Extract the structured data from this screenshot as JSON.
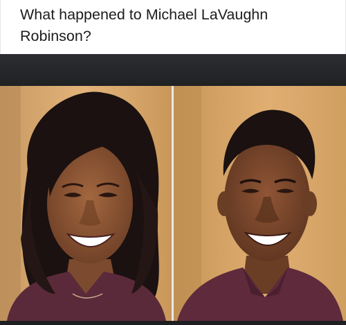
{
  "post": {
    "caption": "What happened to Michael LaVaughn Robinson?"
  },
  "photos": [
    {
      "subject": "woman-smiling",
      "shirt_color": "#5a2a3a",
      "background_color": "#d9a96a"
    },
    {
      "subject": "man-smiling",
      "shirt_color": "#5e2a3c",
      "background_color": "#d6a463"
    }
  ],
  "colors": {
    "caption_text": "#1c1c1c",
    "dark_band": "#232527",
    "skin": "#8a5538",
    "hair": "#1a1110"
  }
}
